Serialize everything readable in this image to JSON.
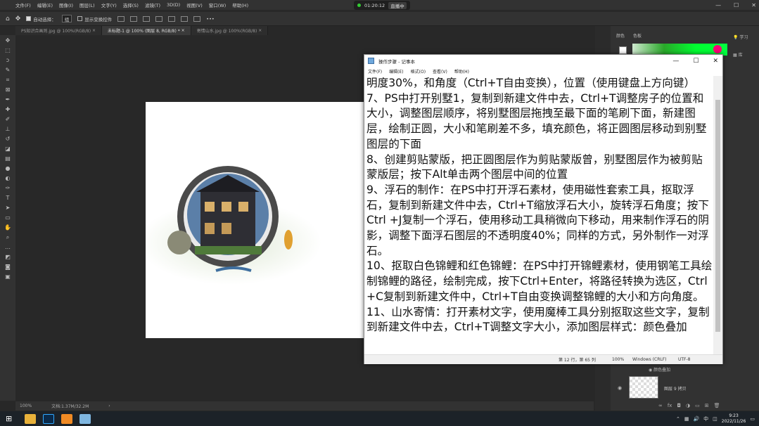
{
  "photoshop": {
    "menu": [
      "文件(F)",
      "编辑(E)",
      "图像(I)",
      "图层(L)",
      "文字(Y)",
      "选择(S)",
      "滤镜(T)",
      "3D(D)",
      "视图(V)",
      "窗口(W)",
      "帮助(H)"
    ],
    "recording": {
      "time": "01:20:12",
      "label": "直播中"
    },
    "options": {
      "auto_select": "自动选择：",
      "group": "组",
      "transform": "显示变换控件"
    },
    "tabs": [
      "PS知识合画则.jpg @ 100%(RGB/8)",
      "未标题-1 @ 100% (图层 8, RGB/8) *",
      "寄情山水.jpg @ 100%(RGB/8)"
    ],
    "active_tab": 1,
    "status": {
      "zoom": "100%",
      "doc": "文档:1.37M/32.2M"
    },
    "panel": {
      "tab1": "颜色",
      "tab2": "色板",
      "side": [
        "学习",
        "库"
      ],
      "layer_fx": "颜色叠加",
      "layer_name": "图层 9 拷贝"
    },
    "accent_color": "#ff0077"
  },
  "notepad": {
    "title": "操作步骤 - 记事本",
    "menu": [
      "文件(F)",
      "编辑(E)",
      "格式(O)",
      "查看(V)",
      "帮助(H)"
    ],
    "text": "明度30%，和角度（Ctrl+T自由变换），位置（使用键盘上方向键）\n7、PS中打开别墅1，复制到新建文件中去，Ctrl+T调整房子的位置和大小，调整图层顺序，将别墅图层拖拽至最下面的笔刷下面，新建图层，绘制正圆，大小和笔刷差不多，填充颜色，将正圆图层移动到别墅图层的下面\n8、创建剪贴蒙版，把正圆图层作为剪贴蒙版曾，别墅图层作为被剪贴蒙版层；按下Alt单击两个图层中间的位置\n9、浮石的制作：在PS中打开浮石素材，使用磁性套索工具，抠取浮石，复制到新建文件中去，Ctrl+T缩放浮石大小，旋转浮石角度；按下Ctrl +J复制一个浮石，使用移动工具稍微向下移动，用来制作浮石的阴影，调整下面浮石图层的不透明度40%；同样的方式，另外制作一对浮石。\n10、抠取白色锦鲤和红色锦鲤：在PS中打开锦鲤素材，使用钢笔工具绘制锦鲤的路径，绘制完成，按下Ctrl+Enter，将路径转换为选区，Ctrl+C复制到新建文件中，Ctrl+T自由变换调整锦鲤的大小和方向角度。\n11、山水寄情：打开素材文字，使用魔棒工具分别抠取这些文字，复制到新建文件中去，Ctrl+T调整文字大小，添加图层样式：颜色叠加",
    "status": {
      "pos": "第 12 行，第 65 列",
      "zoom": "100%",
      "eol": "Windows (CRLF)",
      "enc": "UTF-8"
    }
  },
  "taskbar": {
    "time": "9:23",
    "date": "2022/11/26",
    "ime": "中"
  }
}
